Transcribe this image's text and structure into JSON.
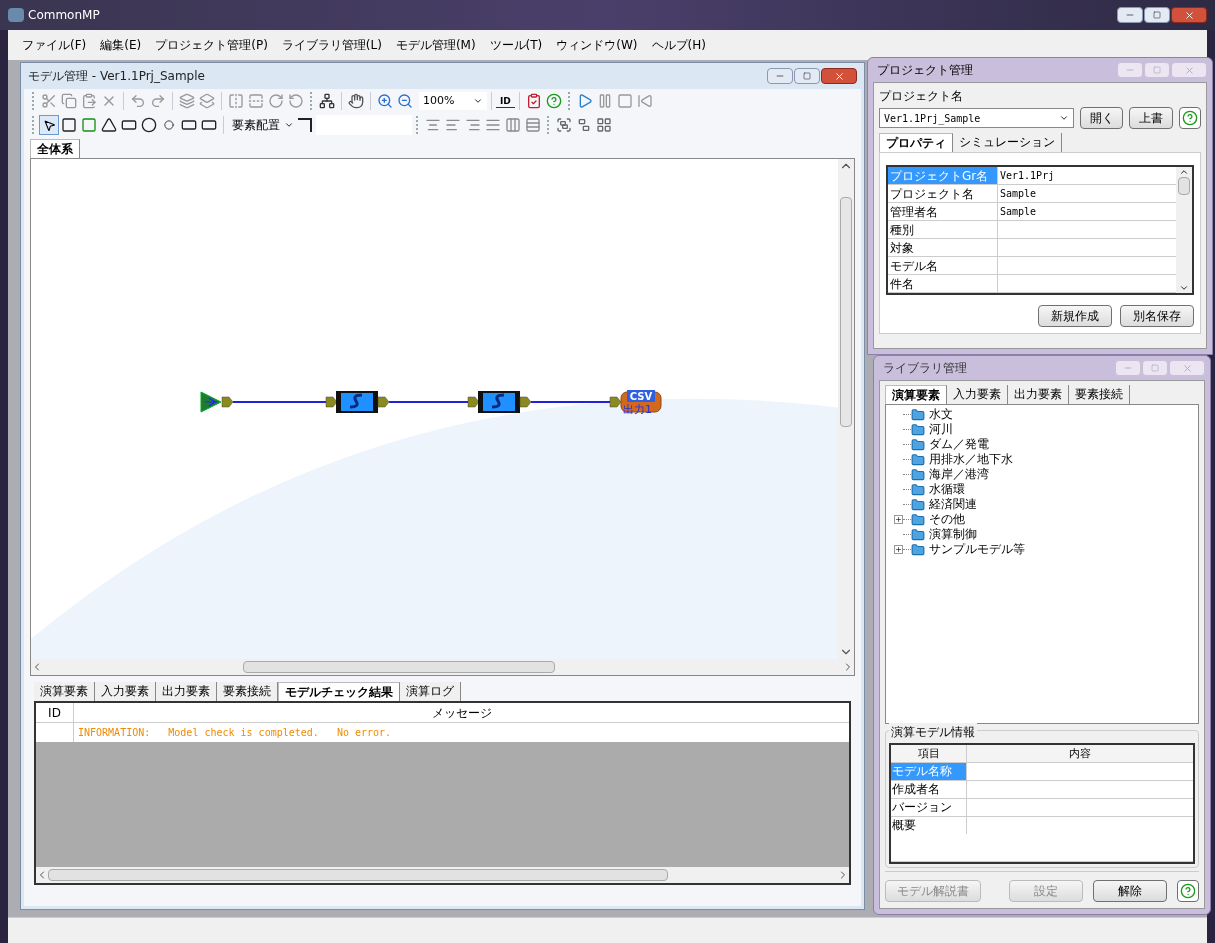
{
  "window": {
    "title": "CommonMP"
  },
  "menu": [
    "ファイル(F)",
    "編集(E)",
    "プロジェクト管理(P)",
    "ライブラリ管理(L)",
    "モデル管理(M)",
    "ツール(T)",
    "ウィンドウ(W)",
    "ヘルプ(H)"
  ],
  "model_window": {
    "title": "モデル管理 - Ver1.1Prj_Sample",
    "zoom": "100%",
    "id_button": "ID",
    "layout_menu": "要素配置",
    "tabs": [
      {
        "label": "全体系",
        "selected": true
      }
    ],
    "nodes": [
      {
        "kind": "source"
      },
      {
        "kind": "calc"
      },
      {
        "kind": "calc"
      },
      {
        "kind": "output",
        "badge": "CSV",
        "label": "出力1"
      }
    ],
    "bottom_tabs": [
      {
        "label": "演算要素",
        "selected": false
      },
      {
        "label": "入力要素",
        "selected": false
      },
      {
        "label": "出力要素",
        "selected": false
      },
      {
        "label": "要素接続",
        "selected": false
      },
      {
        "label": "モデルチェック結果",
        "selected": true
      },
      {
        "label": "演算ログ",
        "selected": false
      }
    ],
    "messages": {
      "columns": [
        "ID",
        "メッセージ"
      ],
      "rows": [
        {
          "message": "INFORMATION:   Model check is completed.   No error."
        }
      ]
    }
  },
  "project_panel": {
    "title": "プロジェクト管理",
    "name_label": "プロジェクト名",
    "project": "Ver1.1Prj_Sample",
    "buttons": [
      "開く",
      "上書"
    ],
    "tabs": [
      {
        "label": "プロパティ",
        "selected": true
      },
      {
        "label": "シミュレーション",
        "selected": false
      }
    ],
    "properties": [
      {
        "name": "プロジェクトGr名",
        "value": "Ver1.1Prj",
        "selected": true
      },
      {
        "name": "プロジェクト名",
        "value": "Sample",
        "selected": false
      },
      {
        "name": "管理者名",
        "value": "Sample",
        "selected": false
      },
      {
        "name": "種別",
        "selected": false
      },
      {
        "name": "対象",
        "selected": false
      },
      {
        "name": "モデル名",
        "selected": false
      },
      {
        "name": "件名",
        "selected": false
      }
    ],
    "actions": [
      "新規作成",
      "別名保存"
    ]
  },
  "library_panel": {
    "title": "ライブラリ管理",
    "tabs": [
      {
        "label": "演算要素",
        "selected": true
      },
      {
        "label": "入力要素",
        "selected": false
      },
      {
        "label": "出力要素",
        "selected": false
      },
      {
        "label": "要素接続",
        "selected": false
      }
    ],
    "tree": [
      {
        "label": "水文",
        "kind": "leaf"
      },
      {
        "label": "河川",
        "kind": "leaf"
      },
      {
        "label": "ダム／発電",
        "kind": "leaf"
      },
      {
        "label": "用排水／地下水",
        "kind": "leaf"
      },
      {
        "label": "海岸／港湾",
        "kind": "leaf"
      },
      {
        "label": "水循環",
        "kind": "leaf"
      },
      {
        "label": "経済関連",
        "kind": "leaf"
      },
      {
        "label": "その他",
        "kind": "group"
      },
      {
        "label": "演算制御",
        "kind": "leaf"
      },
      {
        "label": "サンプルモデル等",
        "kind": "group"
      }
    ],
    "info": {
      "legend": "演算モデル情報",
      "columns": [
        "項目",
        "内容"
      ],
      "rows": [
        {
          "name": "モデル名称",
          "selected": true
        },
        {
          "name": "作成者名",
          "selected": false
        },
        {
          "name": "バージョン",
          "selected": false
        },
        {
          "name": "概要",
          "selected": false
        }
      ]
    },
    "buttons": [
      {
        "label": "モデル解説書",
        "disabled": true
      },
      {
        "label": "設定",
        "disabled": true
      },
      {
        "label": "解除",
        "disabled": false
      }
    ]
  }
}
